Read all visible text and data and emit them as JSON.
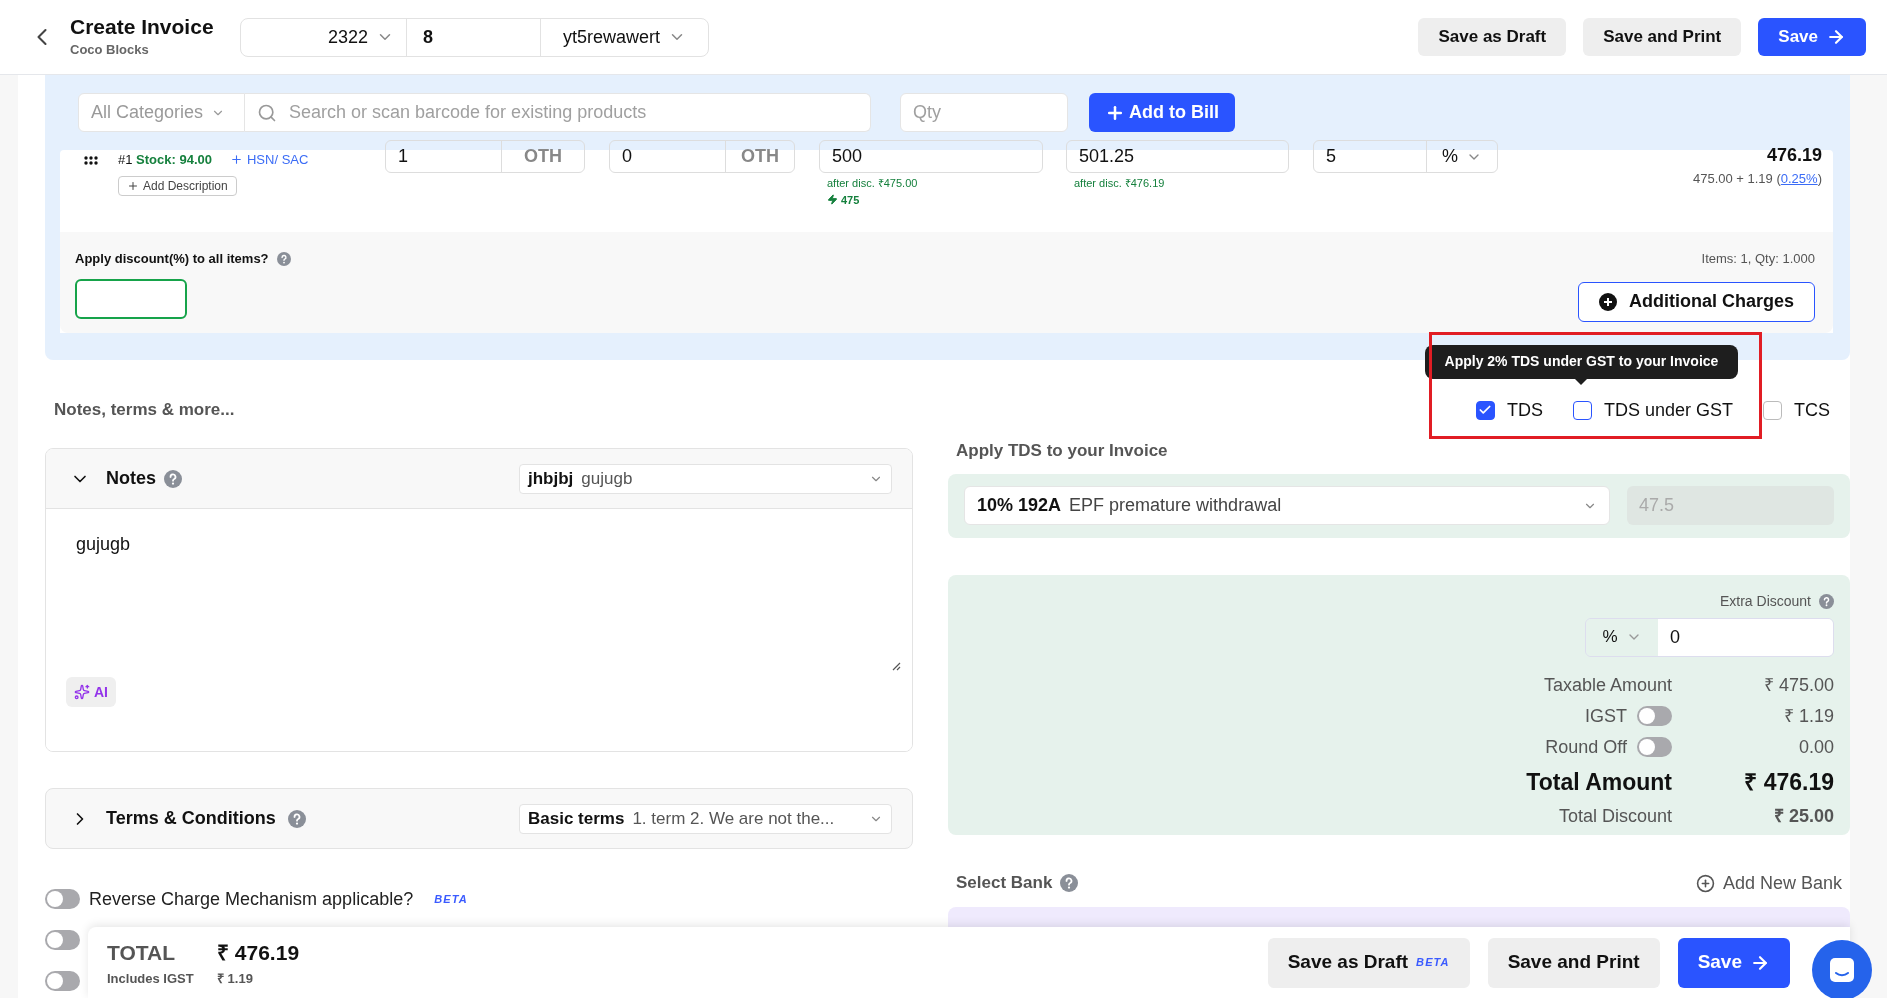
{
  "header": {
    "title": "Create Invoice",
    "subtitle": "Coco Blocks",
    "series_prefix": "2322",
    "series_number": "8",
    "series_suffix": "yt5rewawert",
    "buttons": [
      {
        "label": "Save as Draft",
        "kind": "secondary"
      },
      {
        "label": "Save and Print",
        "kind": "secondary"
      },
      {
        "label": "Save",
        "kind": "primary"
      }
    ]
  },
  "product_search": {
    "category": "All Categories",
    "placeholder": "Search or scan barcode for existing products",
    "qty_placeholder": "Qty",
    "add_button": "Add to Bill"
  },
  "item": {
    "index": "#1",
    "stock": "Stock: 94.00",
    "hsn": "HSN/ SAC",
    "add_description": "Add Description",
    "qty": "1",
    "qty_unit": "OTH",
    "free_qty": "0",
    "free_unit": "OTH",
    "price": "500",
    "price_note": "after disc. ₹475.00",
    "price_hint": "475",
    "price_with_tax": "501.25",
    "price_with_tax_note": "after disc. ₹476.19",
    "discount": "5",
    "discount_type": "%",
    "amount": "476.19",
    "amount_detail": "475.00 + 1.19 (",
    "tax_rate": "0.25%",
    "amount_detail_end": ")"
  },
  "discount_all_label": "Apply discount(%) to all items?",
  "items_summary": "Items: 1, Qty: 1.000",
  "additional_charges": "Additional Charges",
  "notes_section_title": "Notes, terms & more...",
  "tax_options": [
    {
      "label": "TDS",
      "checked": true
    },
    {
      "label": "TDS under GST",
      "checked": false,
      "tooltip": "Apply 2% TDS under GST to your Invoice"
    },
    {
      "label": "TCS",
      "checked": false
    }
  ],
  "notes": {
    "title": "Notes",
    "expanded": true,
    "template_name": "jhbjbj",
    "template_preview": "gujugb",
    "text": "gujugb",
    "ai_button": "AI"
  },
  "terms": {
    "title": "Terms & Conditions",
    "expanded": false,
    "template_name": "Basic terms",
    "template_preview": "1. term 2. We are not the..."
  },
  "toggles": [
    {
      "label": "Reverse Charge Mechanism applicable?",
      "badge": "BETA",
      "on": false
    },
    {
      "on": false
    },
    {
      "on": false
    }
  ],
  "tds": {
    "title": "Apply TDS to your Invoice",
    "rate": "10% 192A",
    "section": "EPF premature withdrawal",
    "amount": "47.5"
  },
  "summary": {
    "extra_discount_label": "Extra Discount",
    "discount_type": "%",
    "extra_discount": "0",
    "rows": [
      {
        "label": "Taxable Amount",
        "value": "₹ 475.00",
        "kind": "plain"
      },
      {
        "label": "IGST",
        "value": "₹ 1.19",
        "kind": "toggle",
        "on": false
      },
      {
        "label": "Round Off",
        "value": "0.00",
        "kind": "toggle",
        "on": false
      },
      {
        "label": "Total Amount",
        "value": "₹ 476.19",
        "kind": "total"
      },
      {
        "label": "Total Discount",
        "value": "₹ 25.00",
        "kind": "discount"
      }
    ]
  },
  "bank": {
    "title": "Select Bank",
    "add": "Add New Bank"
  },
  "footer": {
    "total_label": "TOTAL",
    "total": "₹ 476.19",
    "tax_label": "Includes IGST",
    "tax": "₹ 1.19",
    "buttons": [
      {
        "label": "Save as Draft",
        "badge": "BETA",
        "kind": "secondary"
      },
      {
        "label": "Save and Print",
        "kind": "secondary"
      },
      {
        "label": "Save",
        "kind": "primary"
      }
    ]
  }
}
